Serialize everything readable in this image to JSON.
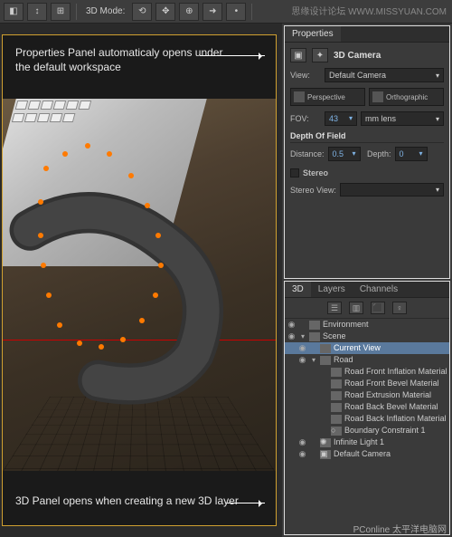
{
  "watermark_top": "思缘设计论坛 WWW.MISSYUAN.COM",
  "watermark_bot": "PConline 太平洋电脑网",
  "toolbar": {
    "mode_label": "3D Mode:"
  },
  "annotations": {
    "props_note": "Properties Panel automaticaly opens under the default workspace",
    "panel3d_note": "3D Panel opens when creating a new 3D layer"
  },
  "properties": {
    "tab": "Properties",
    "title": "3D Camera",
    "view_label": "View:",
    "view_value": "Default Camera",
    "perspective": "Perspective",
    "orthographic": "Orthographic",
    "fov_label": "FOV:",
    "fov_value": "43",
    "fov_unit": "mm lens",
    "dof_title": "Depth Of Field",
    "distance_label": "Distance:",
    "distance_value": "0.5",
    "depth_label": "Depth:",
    "depth_value": "0",
    "stereo_label": "Stereo",
    "stereo_view_label": "Stereo View:"
  },
  "panel3d": {
    "tabs": {
      "t3d": "3D",
      "layers": "Layers",
      "channels": "Channels"
    },
    "items": {
      "environment": "Environment",
      "scene": "Scene",
      "current_view": "Current View",
      "road": "Road",
      "mat_front_inflation": "Road Front Inflation Material",
      "mat_front_bevel": "Road Front Bevel Material",
      "mat_extrusion": "Road Extrusion Material",
      "mat_back_bevel": "Road Back Bevel Material",
      "mat_back_inflation": "Road Back Inflation Material",
      "boundary": "Boundary Constraint 1",
      "light": "Infinite Light 1",
      "camera": "Default Camera"
    }
  }
}
